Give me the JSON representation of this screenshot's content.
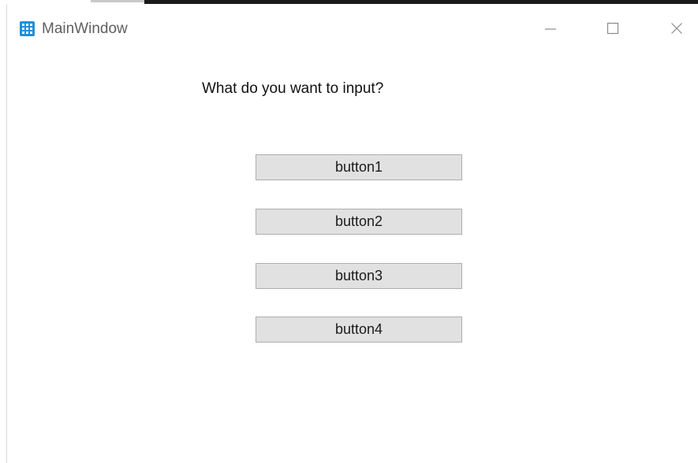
{
  "window": {
    "title": "MainWindow",
    "app_icon": "grid-app-icon",
    "controls": {
      "minimize_icon": "minimize-icon",
      "maximize_icon": "maximize-icon",
      "close_icon": "close-icon"
    }
  },
  "main": {
    "prompt": "What do you want to input?",
    "buttons": [
      {
        "label": "button1"
      },
      {
        "label": "button2"
      },
      {
        "label": "button3"
      },
      {
        "label": "button4"
      }
    ]
  },
  "colors": {
    "app_icon_bg": "#1e90d8",
    "button_bg": "#e1e1e1",
    "button_border": "#adadad"
  }
}
